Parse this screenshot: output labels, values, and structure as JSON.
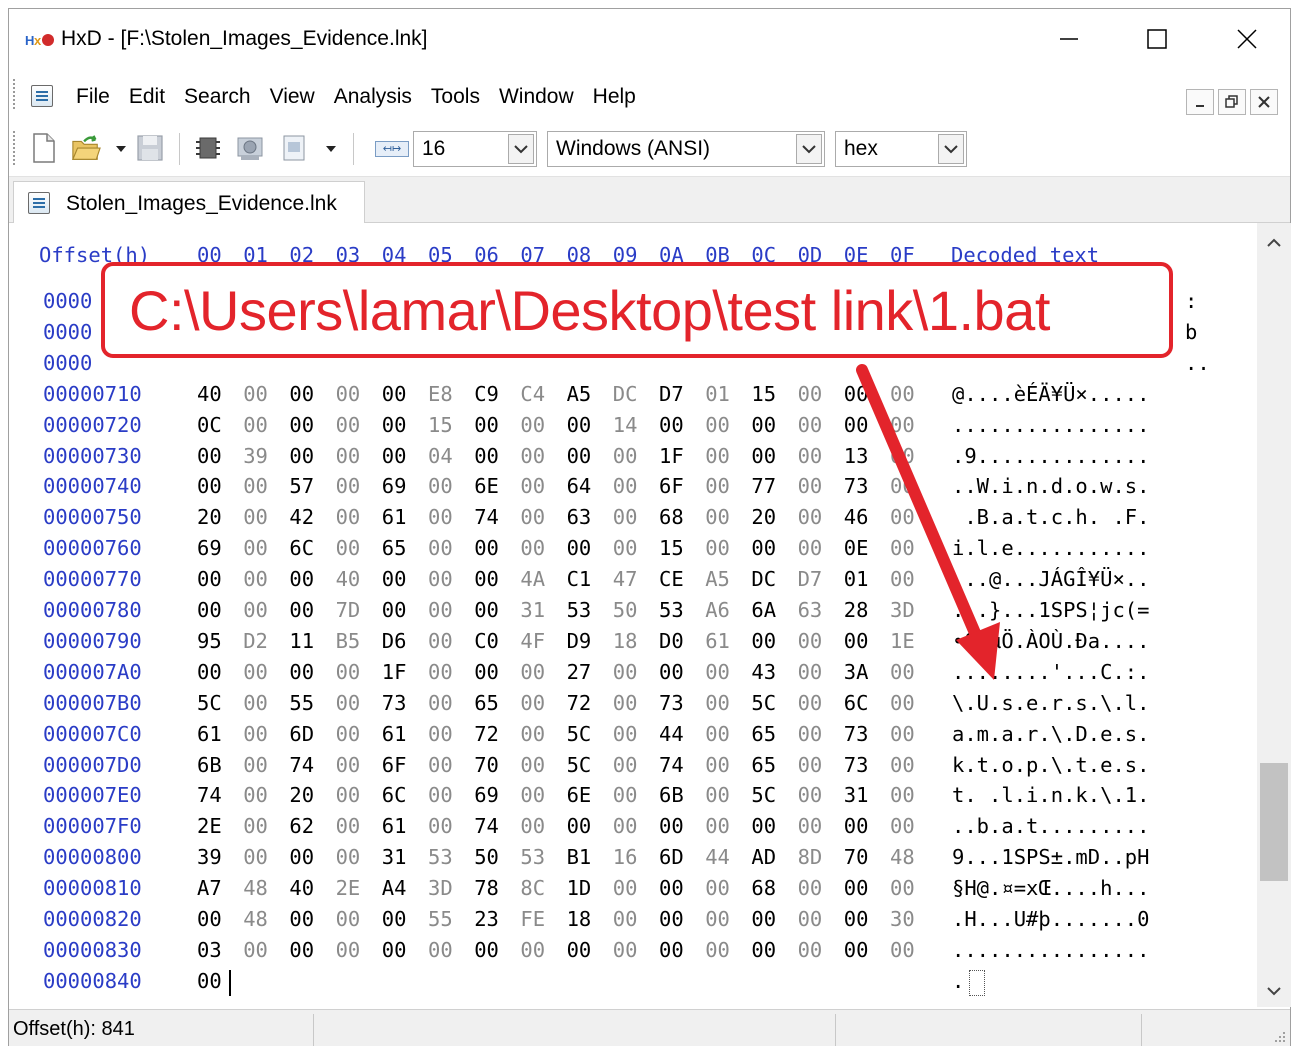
{
  "window": {
    "title": "HxD - [F:\\Stolen_Images_Evidence.lnk]"
  },
  "menu": {
    "items": [
      "File",
      "Edit",
      "Search",
      "View",
      "Analysis",
      "Tools",
      "Window",
      "Help"
    ]
  },
  "toolbar": {
    "bytes_per_row": "16",
    "charset": "Windows (ANSI)",
    "offset_base": "hex"
  },
  "tab": {
    "label": "Stolen_Images_Evidence.lnk"
  },
  "hex_view": {
    "header_offset": "Offset(h)",
    "header_columns": [
      "00",
      "01",
      "02",
      "03",
      "04",
      "05",
      "06",
      "07",
      "08",
      "09",
      "0A",
      "0B",
      "0C",
      "0D",
      "0E",
      "0F"
    ],
    "header_decoded": "Decoded text",
    "rows": [
      {
        "offset": "0000",
        "bytes": [],
        "decoded": ":"
      },
      {
        "offset": "0000",
        "bytes": [],
        "decoded": "b"
      },
      {
        "offset": "0000",
        "bytes": [],
        "decoded": ".."
      },
      {
        "offset": "00000710",
        "bytes": [
          "40",
          "00",
          "00",
          "00",
          "00",
          "E8",
          "C9",
          "C4",
          "A5",
          "DC",
          "D7",
          "01",
          "15",
          "00",
          "00",
          "00"
        ],
        "decoded": "@....èÉÄ¥Ü×....."
      },
      {
        "offset": "00000720",
        "bytes": [
          "0C",
          "00",
          "00",
          "00",
          "00",
          "15",
          "00",
          "00",
          "00",
          "14",
          "00",
          "00",
          "00",
          "00",
          "00",
          "00"
        ],
        "decoded": "................"
      },
      {
        "offset": "00000730",
        "bytes": [
          "00",
          "39",
          "00",
          "00",
          "00",
          "04",
          "00",
          "00",
          "00",
          "00",
          "1F",
          "00",
          "00",
          "00",
          "13",
          "00"
        ],
        "decoded": ".9.............."
      },
      {
        "offset": "00000740",
        "bytes": [
          "00",
          "00",
          "57",
          "00",
          "69",
          "00",
          "6E",
          "00",
          "64",
          "00",
          "6F",
          "00",
          "77",
          "00",
          "73",
          "00"
        ],
        "decoded": "..W.i.n.d.o.w.s."
      },
      {
        "offset": "00000750",
        "bytes": [
          "20",
          "00",
          "42",
          "00",
          "61",
          "00",
          "74",
          "00",
          "63",
          "00",
          "68",
          "00",
          "20",
          "00",
          "46",
          "00"
        ],
        "decoded": " .B.a.t.c.h. .F."
      },
      {
        "offset": "00000760",
        "bytes": [
          "69",
          "00",
          "6C",
          "00",
          "65",
          "00",
          "00",
          "00",
          "00",
          "00",
          "15",
          "00",
          "00",
          "00",
          "0E",
          "00"
        ],
        "decoded": "i.l.e..........."
      },
      {
        "offset": "00000770",
        "bytes": [
          "00",
          "00",
          "00",
          "40",
          "00",
          "00",
          "00",
          "4A",
          "C1",
          "47",
          "CE",
          "A5",
          "DC",
          "D7",
          "01",
          "00"
        ],
        "decoded": "...@...JÁGÎ¥Ü×.."
      },
      {
        "offset": "00000780",
        "bytes": [
          "00",
          "00",
          "00",
          "7D",
          "00",
          "00",
          "00",
          "31",
          "53",
          "50",
          "53",
          "A6",
          "6A",
          "63",
          "28",
          "3D"
        ],
        "decoded": "...}...1SPS¦jc(="
      },
      {
        "offset": "00000790",
        "bytes": [
          "95",
          "D2",
          "11",
          "B5",
          "D6",
          "00",
          "C0",
          "4F",
          "D9",
          "18",
          "D0",
          "61",
          "00",
          "00",
          "00",
          "1E"
        ],
        "decoded": "•Ò.µÖ.ÀOÙ.Ða...."
      },
      {
        "offset": "000007A0",
        "bytes": [
          "00",
          "00",
          "00",
          "00",
          "1F",
          "00",
          "00",
          "00",
          "27",
          "00",
          "00",
          "00",
          "43",
          "00",
          "3A",
          "00"
        ],
        "decoded": "........'...C.:."
      },
      {
        "offset": "000007B0",
        "bytes": [
          "5C",
          "00",
          "55",
          "00",
          "73",
          "00",
          "65",
          "00",
          "72",
          "00",
          "73",
          "00",
          "5C",
          "00",
          "6C",
          "00"
        ],
        "decoded": "\\.U.s.e.r.s.\\.l."
      },
      {
        "offset": "000007C0",
        "bytes": [
          "61",
          "00",
          "6D",
          "00",
          "61",
          "00",
          "72",
          "00",
          "5C",
          "00",
          "44",
          "00",
          "65",
          "00",
          "73",
          "00"
        ],
        "decoded": "a.m.a.r.\\.D.e.s."
      },
      {
        "offset": "000007D0",
        "bytes": [
          "6B",
          "00",
          "74",
          "00",
          "6F",
          "00",
          "70",
          "00",
          "5C",
          "00",
          "74",
          "00",
          "65",
          "00",
          "73",
          "00"
        ],
        "decoded": "k.t.o.p.\\.t.e.s."
      },
      {
        "offset": "000007E0",
        "bytes": [
          "74",
          "00",
          "20",
          "00",
          "6C",
          "00",
          "69",
          "00",
          "6E",
          "00",
          "6B",
          "00",
          "5C",
          "00",
          "31",
          "00"
        ],
        "decoded": "t. .l.i.n.k.\\.1."
      },
      {
        "offset": "000007F0",
        "bytes": [
          "2E",
          "00",
          "62",
          "00",
          "61",
          "00",
          "74",
          "00",
          "00",
          "00",
          "00",
          "00",
          "00",
          "00",
          "00",
          "00"
        ],
        "decoded": "..b.a.t........."
      },
      {
        "offset": "00000800",
        "bytes": [
          "39",
          "00",
          "00",
          "00",
          "31",
          "53",
          "50",
          "53",
          "B1",
          "16",
          "6D",
          "44",
          "AD",
          "8D",
          "70",
          "48"
        ],
        "decoded": "9...1SPS±.mD..pH"
      },
      {
        "offset": "00000810",
        "bytes": [
          "A7",
          "48",
          "40",
          "2E",
          "A4",
          "3D",
          "78",
          "8C",
          "1D",
          "00",
          "00",
          "00",
          "68",
          "00",
          "00",
          "00"
        ],
        "decoded": "§H@.¤=xŒ....h..."
      },
      {
        "offset": "00000820",
        "bytes": [
          "00",
          "48",
          "00",
          "00",
          "00",
          "55",
          "23",
          "FE",
          "18",
          "00",
          "00",
          "00",
          "00",
          "00",
          "00",
          "30"
        ],
        "decoded": ".H...U#þ.......0"
      },
      {
        "offset": "00000830",
        "bytes": [
          "03",
          "00",
          "00",
          "00",
          "00",
          "00",
          "00",
          "00",
          "00",
          "00",
          "00",
          "00",
          "00",
          "00",
          "00",
          "00"
        ],
        "decoded": "................"
      },
      {
        "offset": "00000840",
        "bytes": [
          "00"
        ],
        "decoded": "."
      }
    ]
  },
  "status": {
    "offset_text": "Offset(h): 841"
  },
  "annotation": {
    "text": "C:\\Users\\lamar\\Desktop\\test link\\1.bat",
    "color": "#e3242b"
  }
}
